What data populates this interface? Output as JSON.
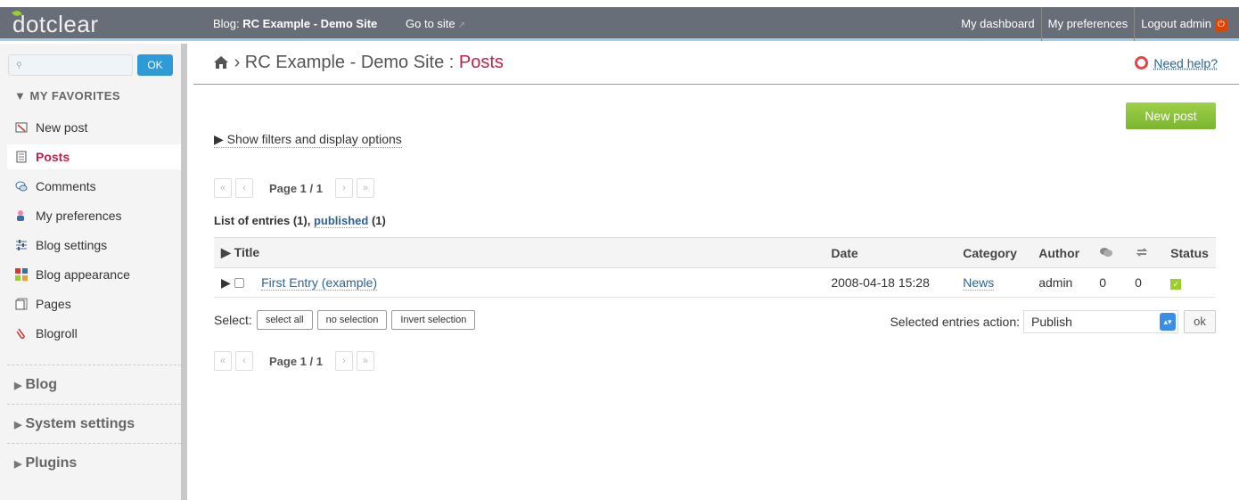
{
  "topbar": {
    "logo": "dotclear",
    "blog_label": "Blog:",
    "blog_name": "RC Example - Demo Site",
    "goto_site": "Go to site",
    "links": [
      "My dashboard",
      "My preferences",
      "Logout admin"
    ]
  },
  "sidebar": {
    "search_ok": "OK",
    "favorites_title": "My favorites",
    "favorites": [
      {
        "label": "New post",
        "icon": "new-post-icon"
      },
      {
        "label": "Posts",
        "icon": "posts-icon"
      },
      {
        "label": "Comments",
        "icon": "comments-icon"
      },
      {
        "label": "My preferences",
        "icon": "user-prefs-icon"
      },
      {
        "label": "Blog settings",
        "icon": "blog-settings-icon"
      },
      {
        "label": "Blog appearance",
        "icon": "blog-appearance-icon"
      },
      {
        "label": "Pages",
        "icon": "pages-icon"
      },
      {
        "label": "Blogroll",
        "icon": "blogroll-icon"
      }
    ],
    "sections": [
      "Blog",
      "System settings",
      "Plugins"
    ]
  },
  "main": {
    "breadcrumb_blog": "RC Example - Demo Site",
    "breadcrumb_sep": " : ",
    "breadcrumb_page": "Posts",
    "help": "Need help?",
    "new_post": "New post",
    "filters": "Show filters and display options",
    "pager_text": "Page 1 / 1",
    "list_title_prefix": "List of entries (1), ",
    "list_title_link": "published",
    "list_title_suffix": " (1)",
    "columns": [
      "Title",
      "Date",
      "Category",
      "Author",
      "Status"
    ],
    "row": {
      "title": "First Entry (example)",
      "date": "2008-04-18 15:28",
      "category": "News",
      "author": "admin",
      "comments": "0",
      "trackbacks": "0"
    },
    "select_label": "Select:",
    "select_buttons": [
      "select all",
      "no selection",
      "Invert selection"
    ],
    "action_label": "Selected entries action:",
    "action_value": "Publish",
    "action_ok": "ok"
  },
  "colors": {
    "accent": "#c02148",
    "link": "#2a6496",
    "topbar": "#676e78",
    "new_post_button": "#8bc34a"
  }
}
